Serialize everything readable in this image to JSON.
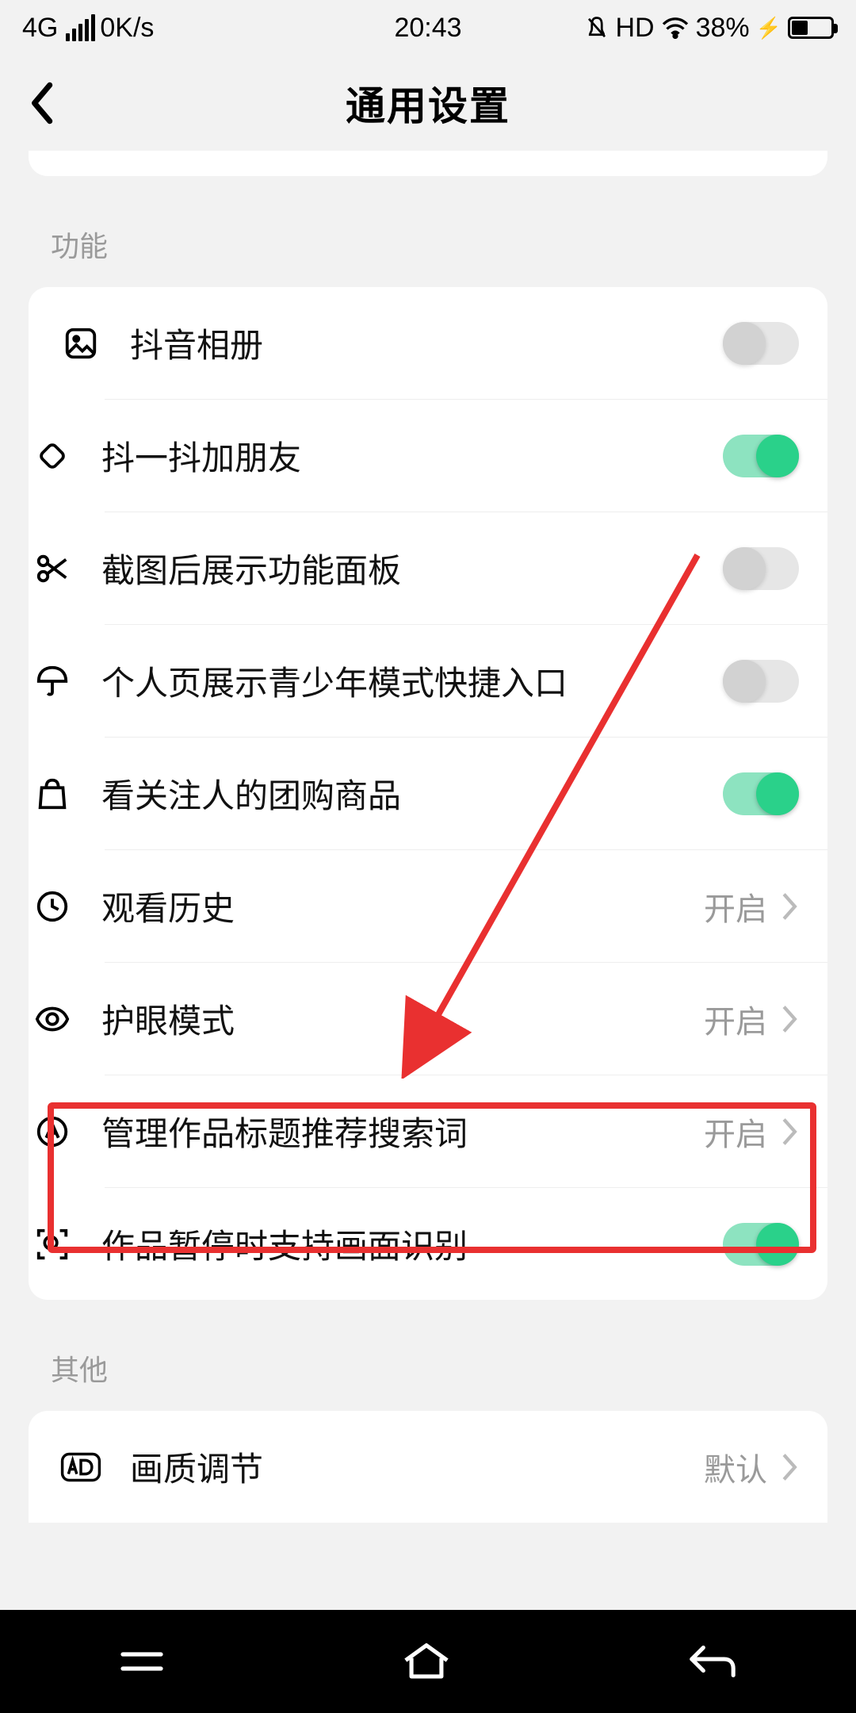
{
  "status": {
    "network": "4G",
    "speed": "0K/s",
    "time": "20:43",
    "hd": "HD",
    "battery_pct": "38%"
  },
  "header": {
    "title": "通用设置"
  },
  "sections": {
    "features_label": "功能",
    "other_label": "其他"
  },
  "rows": {
    "album": "抖音相册",
    "shake": "抖一抖加朋友",
    "screenshot": "截图后展示功能面板",
    "teen": "个人页展示青少年模式快捷入口",
    "group_buy": "看关注人的团购商品",
    "history": "观看历史",
    "eye": "护眼模式",
    "search_words": "管理作品标题推荐搜索词",
    "pause_detect": "作品暂停时支持画面识别",
    "quality": "画质调节"
  },
  "values": {
    "open": "开启",
    "default": "默认"
  }
}
